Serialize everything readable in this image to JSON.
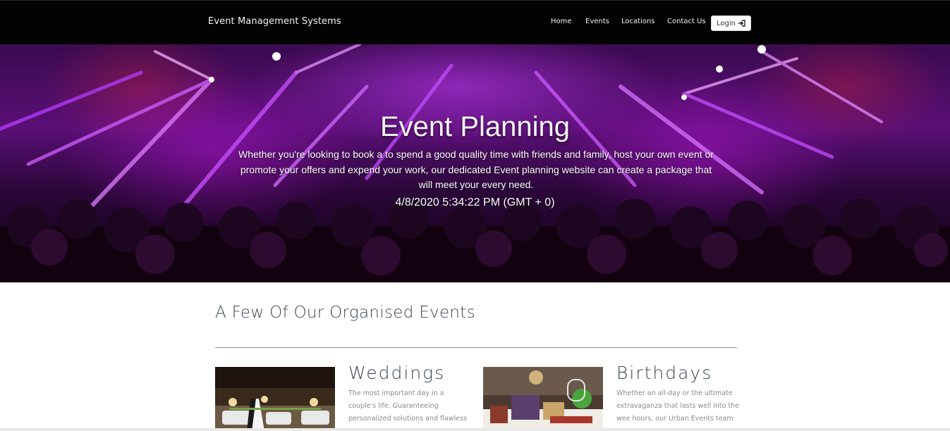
{
  "brand": "Event Management Systems",
  "nav": {
    "items": [
      "Home",
      "Events",
      "Locations",
      "Contact Us"
    ],
    "login_label": "Login",
    "login_icon": "sign-in-icon"
  },
  "hero": {
    "title": "Event Planning",
    "subtitle": "Whether you're looking to book a to spend a good quality time with friends and family, host your own event or promote your offers and expend your work, our dedicated Event planning website can create a package that will meet your every need.",
    "datetime": "4/8/2020 5:34:22 PM (GMT + 0)"
  },
  "events_section": {
    "title": "A Few Of Our Organised Events",
    "events": [
      {
        "name": "Weddings",
        "description": "The most important day in a couple's life. Guaranteeing personalized solutions and flawless"
      },
      {
        "name": "Birthdays",
        "description": "Whether an all-day or the ultimate extravaganza that lasts well into the wee hours, our Urban Events team"
      }
    ]
  },
  "colors": {
    "navbar_bg": "#030303",
    "hero_accent": "#b21fe0",
    "heading_text": "#3b4652",
    "body_text": "#8a8a8a"
  }
}
